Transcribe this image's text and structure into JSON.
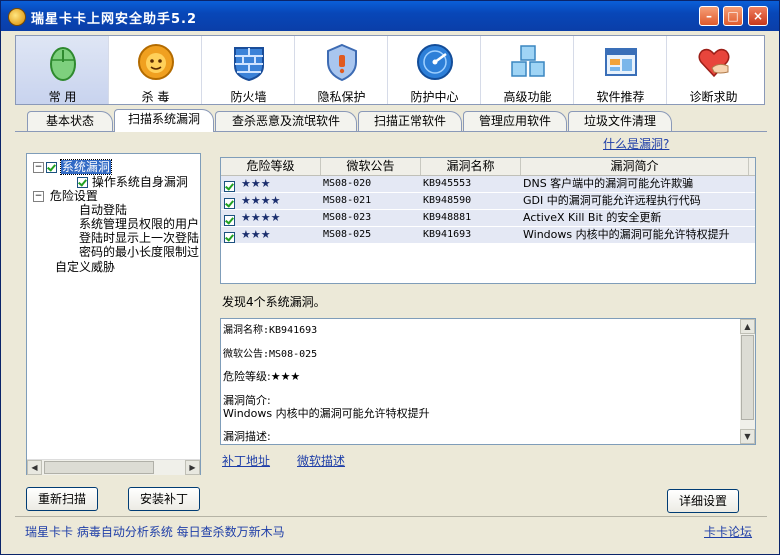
{
  "window": {
    "title": "瑞星卡卡上网安全助手5.2",
    "min_glyph": "–",
    "max_glyph": "□",
    "close_glyph": "×"
  },
  "toolbar": {
    "items": [
      {
        "label": "常 用",
        "icon": "mouse-icon"
      },
      {
        "label": "杀 毒",
        "icon": "lion-icon"
      },
      {
        "label": "防火墙",
        "icon": "firewall-icon"
      },
      {
        "label": "隐私保护",
        "icon": "shield-icon"
      },
      {
        "label": "防护中心",
        "icon": "radar-icon"
      },
      {
        "label": "高级功能",
        "icon": "cubes-icon"
      },
      {
        "label": "软件推荐",
        "icon": "window-icon"
      },
      {
        "label": "诊断求助",
        "icon": "heart-hand-icon"
      }
    ]
  },
  "tabs": {
    "items": [
      {
        "label": "基本状态"
      },
      {
        "label": "扫描系统漏洞"
      },
      {
        "label": "查杀恶意及流氓软件"
      },
      {
        "label": "扫描正常软件"
      },
      {
        "label": "管理应用软件"
      },
      {
        "label": "垃圾文件清理"
      }
    ],
    "help_link": "什么是漏洞?"
  },
  "tree": {
    "root1": "系统漏洞",
    "child1": "操作系统自身漏洞",
    "root2": "危险设置",
    "children2": [
      "自动登陆",
      "系统管理员权限的用户",
      "登陆时显示上一次登陆",
      "密码的最小长度限制过"
    ],
    "root3": "自定义威胁"
  },
  "table": {
    "headers": [
      "危险等级",
      "微软公告",
      "漏洞名称",
      "漏洞简介"
    ],
    "rows": [
      {
        "stars": "★★★",
        "bulletin": "MS08-020",
        "kb": "KB945553",
        "desc": "DNS 客户端中的漏洞可能允许欺骗"
      },
      {
        "stars": "★★★★",
        "bulletin": "MS08-021",
        "kb": "KB948590",
        "desc": "GDI 中的漏洞可能允许远程执行代码"
      },
      {
        "stars": "★★★★",
        "bulletin": "MS08-023",
        "kb": "KB948881",
        "desc": "ActiveX Kill Bit 的安全更新"
      },
      {
        "stars": "★★★",
        "bulletin": "MS08-025",
        "kb": "KB941693",
        "desc": "Windows 内核中的漏洞可能允许特权提升"
      }
    ]
  },
  "found_text": "发现4个系统漏洞。",
  "detail": {
    "name_line": "漏洞名称:KB941693",
    "bulletin_line": "微软公告:MS08-025",
    "level_line": "危险等级:★★★",
    "intro_label": "漏洞简介:",
    "intro_text": "Windows 内核中的漏洞可能允许特权提升",
    "desc_label": "漏洞描述:"
  },
  "links": {
    "patch": "补丁地址",
    "ms_desc": "微软描述"
  },
  "buttons": {
    "rescan": "重新扫描",
    "install": "安装补丁",
    "settings": "详细设置"
  },
  "footer": {
    "left": "瑞星卡卡 病毒自动分析系统 每日查杀数万新木马",
    "right": "卡卡论坛"
  },
  "colors": {
    "accent": "#0a5fd8",
    "link": "#1f3fa8",
    "row_bg": "#e4e8f4"
  }
}
